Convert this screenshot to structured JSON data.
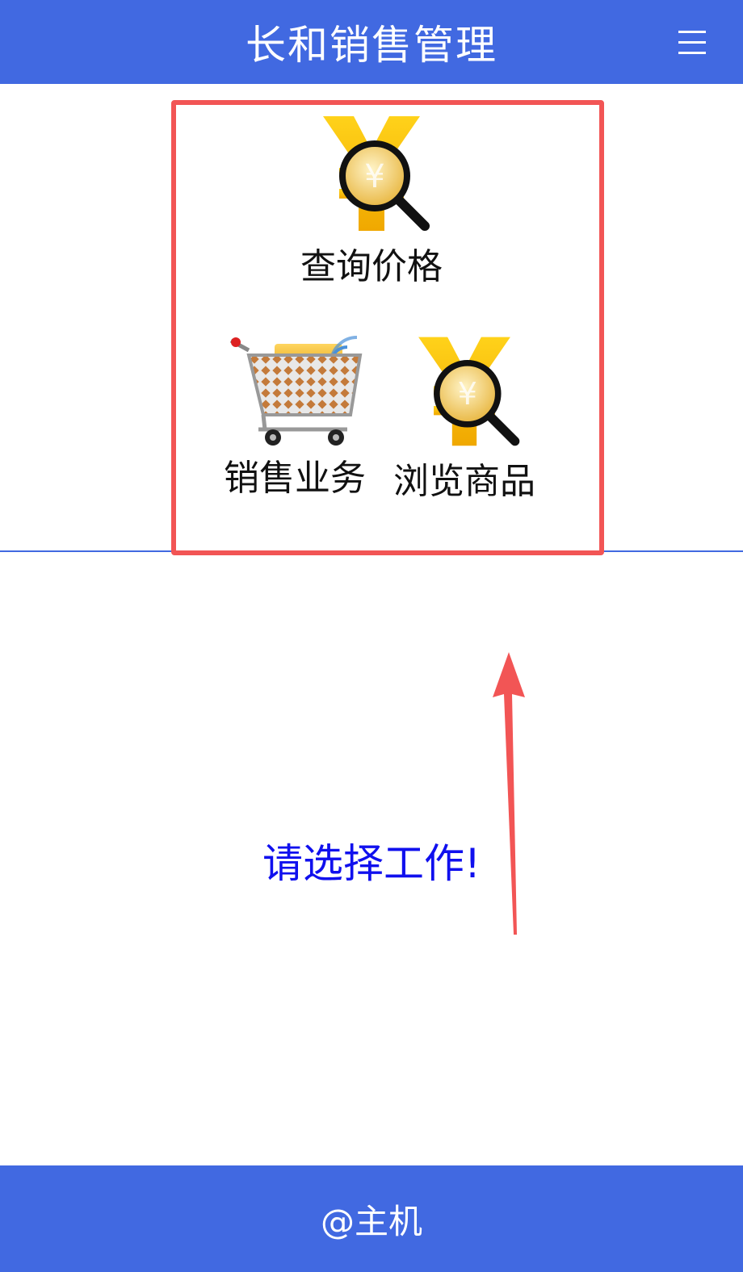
{
  "header": {
    "title": "长和销售管理",
    "menu_icon": "hamburger-menu-icon"
  },
  "menu": {
    "items": [
      {
        "label": "查询价格",
        "icon": "yuan-magnifier-icon"
      },
      {
        "label": "销售业务",
        "icon": "shopping-cart-icon"
      },
      {
        "label": "浏览商品",
        "icon": "yuan-magnifier-icon"
      }
    ]
  },
  "main": {
    "prompt": "请选择工作!"
  },
  "footer": {
    "text": "@主机"
  },
  "colors": {
    "primary": "#4169e1",
    "highlight": "#f25555",
    "prompt": "#1010ee"
  }
}
